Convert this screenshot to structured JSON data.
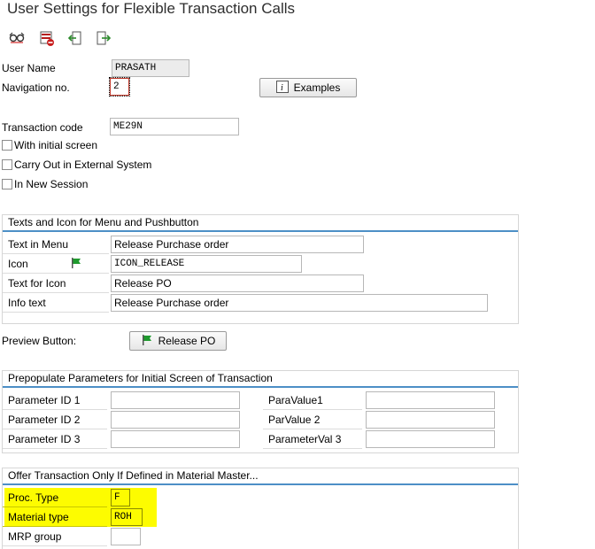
{
  "title": "User Settings for Flexible Transaction Calls",
  "toolbar": {
    "icons": [
      "glasses-icon",
      "delete-icon",
      "back-icon",
      "exit-icon"
    ]
  },
  "header": {
    "user_name_label": "User Name",
    "user_name_value": "PRASATH",
    "nav_no_label": "Navigation no.",
    "nav_no_value": "2",
    "examples_label": "Examples"
  },
  "transaction": {
    "code_label": "Transaction code",
    "code_value": "ME29N",
    "with_initial_screen": "With initial screen",
    "carry_out_external": "Carry Out in External System",
    "in_new_session": "In New Session"
  },
  "texts_group": {
    "title": "Texts and Icon for Menu and Pushbutton",
    "rows": [
      {
        "label": "Text in Menu",
        "value": "Release Purchase order"
      },
      {
        "label": "Icon",
        "value": "ICON_RELEASE"
      },
      {
        "label": "Text for Icon",
        "value": "Release PO"
      },
      {
        "label": "Info text",
        "value": "Release Purchase order"
      }
    ]
  },
  "preview": {
    "label": "Preview Button:",
    "button_label": "Release PO"
  },
  "params_group": {
    "title": "Prepopulate Parameters for Initial Screen of Transaction",
    "rows": [
      {
        "id_label": "Parameter ID 1",
        "val_label": "ParaValue1"
      },
      {
        "id_label": "Parameter ID 2",
        "val_label": "ParValue 2"
      },
      {
        "id_label": "Parameter ID 3",
        "val_label": "ParameterVal 3"
      }
    ]
  },
  "material_group": {
    "title": "Offer Transaction Only If Defined in Material Master...",
    "rows": [
      {
        "label": "Proc. Type",
        "value": "F"
      },
      {
        "label": "Material type",
        "value": "ROH"
      },
      {
        "label": "MRP group",
        "value": ""
      }
    ]
  },
  "colors": {
    "accent_line": "#4d8fc6",
    "highlight": "#fdfc00",
    "flag_green": "#1f9a2e"
  }
}
